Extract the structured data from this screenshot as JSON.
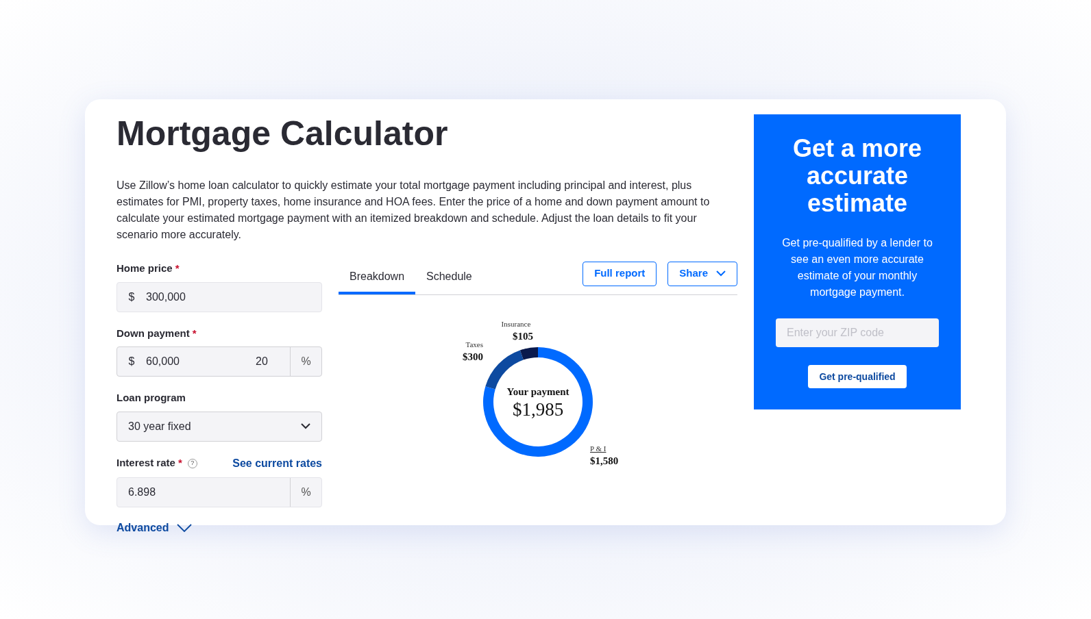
{
  "title": "Mortgage Calculator",
  "description": "Use Zillow’s home loan calculator to quickly estimate your total mortgage payment including principal and interest, plus estimates for PMI, property taxes, home insurance and HOA fees. Enter the price of a home and down payment amount to calculate your estimated mortgage payment with an itemized breakdown and schedule. Adjust the loan details to fit your scenario more accurately.",
  "form": {
    "home_price": {
      "label": "Home price",
      "required": "*",
      "prefix": "$",
      "value": "300,000"
    },
    "down_payment": {
      "label": "Down payment",
      "required": "*",
      "prefix": "$",
      "value": "60,000",
      "percent": "20",
      "suffix": "%"
    },
    "loan_program": {
      "label": "Loan program",
      "value": "30 year fixed"
    },
    "interest_rate": {
      "label": "Interest rate",
      "required": "*",
      "help": "?",
      "link": "See current rates",
      "value": "6.898",
      "suffix": "%"
    },
    "advanced": {
      "label": "Advanced",
      "expanded": false
    }
  },
  "tabs": [
    {
      "label": "Breakdown",
      "selected": true
    },
    {
      "label": "Schedule",
      "selected": false
    }
  ],
  "buttons": {
    "full_report": "Full report",
    "share": "Share"
  },
  "chart": {
    "center_label": "Your payment",
    "center_value": "$1,985",
    "chart_data": {
      "type": "donut",
      "categories": [
        "P & I",
        "Taxes",
        "Insurance"
      ],
      "values": [
        1580,
        300,
        105
      ],
      "value_labels": [
        "$1,580",
        "$300",
        "$105"
      ]
    }
  },
  "promo": {
    "title": "Get a more accurate estimate",
    "text": "Get pre-qualified by a lender to see an even more accurate estimate of your monthly mortgage payment.",
    "zip_placeholder": "Enter your ZIP code",
    "button": "Get pre-qualified"
  }
}
